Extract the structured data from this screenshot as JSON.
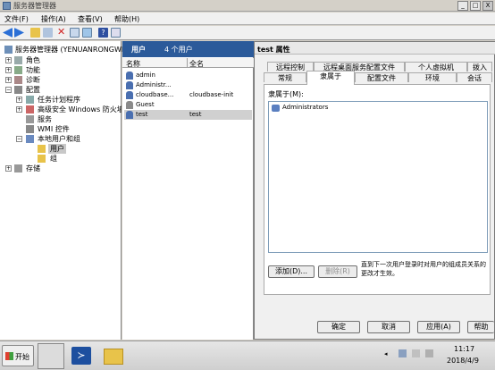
{
  "window": {
    "title": "服务器管理器",
    "btn_min": "_",
    "btn_max": "□",
    "btn_close": "X"
  },
  "menu": [
    "文件(F)",
    "操作(A)",
    "查看(V)",
    "帮助(H)"
  ],
  "tree": {
    "root": "服务器管理器 (YENUANRONGWING",
    "items": [
      "角色",
      "功能",
      "诊断",
      "配置",
      "任务计划程序",
      "高级安全 Windows 防火墙",
      "服务",
      "WMI 控件",
      "本地用户和组",
      "用户",
      "组",
      "存储"
    ]
  },
  "list": {
    "header": "用户",
    "count": "4 个用户",
    "columns": [
      "名称",
      "全名"
    ],
    "rows": [
      {
        "name": "admin",
        "full": ""
      },
      {
        "name": "Administr...",
        "full": ""
      },
      {
        "name": "cloudbase...",
        "full": "cloudbase-init"
      },
      {
        "name": "Guest",
        "full": ""
      },
      {
        "name": "test",
        "full": "test"
      }
    ]
  },
  "dialog": {
    "title": "test 属性",
    "tabs_row1": [
      "远程控制",
      "远程桌面服务配置文件",
      "个人虚拟机",
      "拨入"
    ],
    "tabs_row2": [
      "常规",
      "隶属于",
      "配置文件",
      "环境",
      "会话"
    ],
    "member_label": "隶属于(M):",
    "members": [
      "Administrators"
    ],
    "add": "添加(D)...",
    "remove": "删除(R)",
    "note": "直到下一次用户登录时对用户的组成员关系的更改才生效。",
    "ok": "确定",
    "cancel": "取消",
    "apply": "应用(A)",
    "help": "帮助"
  },
  "taskbar": {
    "start": "开始",
    "time": "11:17",
    "date": "2018/4/9"
  }
}
